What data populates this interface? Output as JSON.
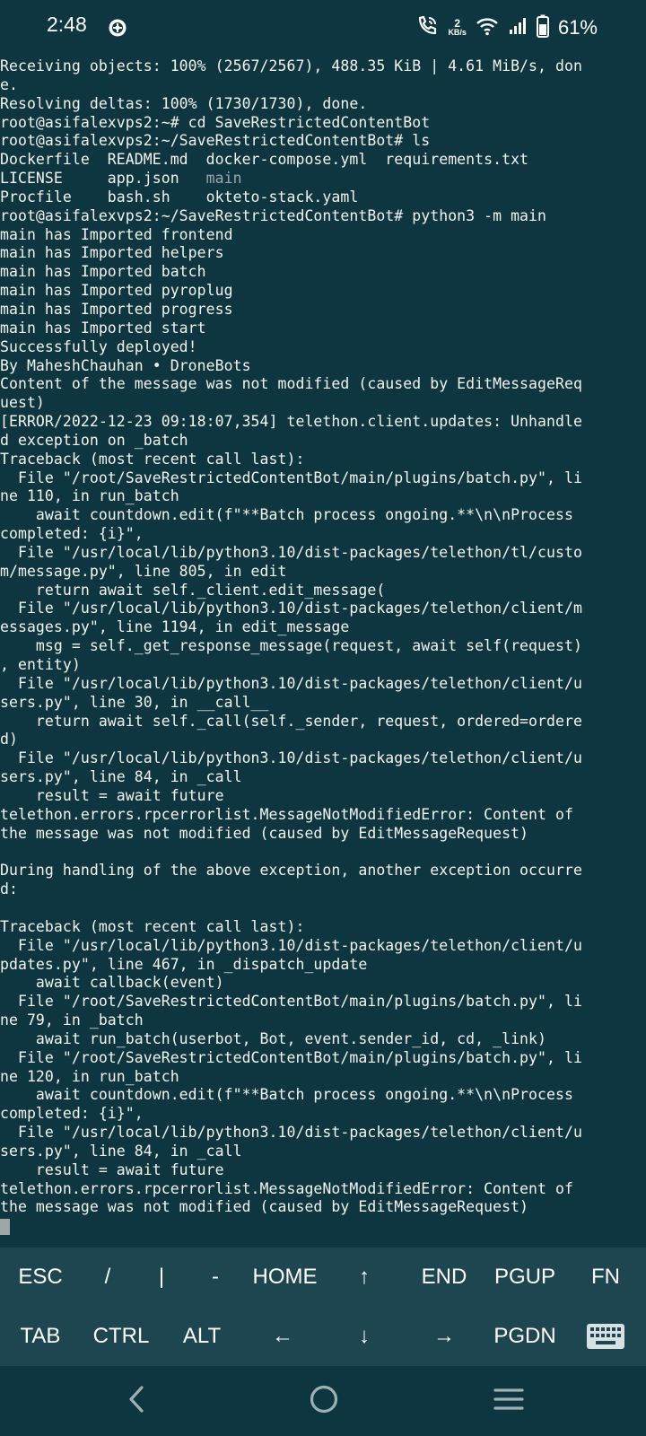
{
  "status_bar": {
    "time": "2:48",
    "net_speed_value": "2",
    "net_speed_unit": "KB/s",
    "battery_percent": "61%",
    "icons": [
      "wifi-calling-icon",
      "wifi-icon",
      "signal-icon",
      "battery-icon",
      "notification-app-icon"
    ]
  },
  "terminal": {
    "lines": [
      "Receiving objects: 100% (2567/2567), 488.35 KiB | 4.61 MiB/s, don",
      "e.",
      "Resolving deltas: 100% (1730/1730), done.",
      "root@asifalexvps2:~# cd SaveRestrictedContentBot",
      "root@asifalexvps2:~/SaveRestrictedContentBot# ls",
      "Dockerfile  README.md  docker-compose.yml  requirements.txt",
      "LICENSE     app.json   main",
      "Procfile    bash.sh    okteto-stack.yaml",
      "root@asifalexvps2:~/SaveRestrictedContentBot# python3 -m main",
      "main has Imported frontend",
      "main has Imported helpers",
      "main has Imported batch",
      "main has Imported pyroplug",
      "main has Imported progress",
      "main has Imported start",
      "Successfully deployed!",
      "By MaheshChauhan • DroneBots",
      "Content of the message was not modified (caused by EditMessageReq",
      "uest)",
      "[ERROR/2022-12-23 09:18:07,354] telethon.client.updates: Unhandle",
      "d exception on _batch",
      "Traceback (most recent call last):",
      "  File \"/root/SaveRestrictedContentBot/main/plugins/batch.py\", li",
      "ne 110, in run_batch",
      "    await countdown.edit(f\"**Batch process ongoing.**\\n\\nProcess",
      "completed: {i}\",",
      "  File \"/usr/local/lib/python3.10/dist-packages/telethon/tl/custo",
      "m/message.py\", line 805, in edit",
      "    return await self._client.edit_message(",
      "  File \"/usr/local/lib/python3.10/dist-packages/telethon/client/m",
      "essages.py\", line 1194, in edit_message",
      "    msg = self._get_response_message(request, await self(request)",
      ", entity)",
      "  File \"/usr/local/lib/python3.10/dist-packages/telethon/client/u",
      "sers.py\", line 30, in __call__",
      "    return await self._call(self._sender, request, ordered=ordere",
      "d)",
      "  File \"/usr/local/lib/python3.10/dist-packages/telethon/client/u",
      "sers.py\", line 84, in _call",
      "    result = await future",
      "telethon.errors.rpcerrorlist.MessageNotModifiedError: Content of",
      "the message was not modified (caused by EditMessageRequest)",
      "",
      "During handling of the above exception, another exception occurre",
      "d:",
      "",
      "Traceback (most recent call last):",
      "  File \"/usr/local/lib/python3.10/dist-packages/telethon/client/u",
      "pdates.py\", line 467, in _dispatch_update",
      "    await callback(event)",
      "  File \"/root/SaveRestrictedContentBot/main/plugins/batch.py\", li",
      "ne 79, in _batch",
      "    await run_batch(userbot, Bot, event.sender_id, cd, _link)",
      "  File \"/root/SaveRestrictedContentBot/main/plugins/batch.py\", li",
      "ne 120, in run_batch",
      "    await countdown.edit(f\"**Batch process ongoing.**\\n\\nProcess",
      "completed: {i}\",",
      "  File \"/usr/local/lib/python3.10/dist-packages/telethon/client/u",
      "sers.py\", line 84, in _call",
      "    result = await future",
      "telethon.errors.rpcerrorlist.MessageNotModifiedError: Content of",
      "the message was not modified (caused by EditMessageRequest)"
    ]
  },
  "extra_keys": {
    "row1": [
      "ESC",
      "/",
      "|",
      "-",
      "HOME",
      "↑",
      "END",
      "PGUP",
      "FN"
    ],
    "row2": [
      "TAB",
      "CTRL",
      "ALT",
      "←",
      "↓",
      "→",
      "PGDN"
    ]
  },
  "nav_bar": {
    "buttons": [
      "back-icon",
      "home-icon",
      "recents-icon"
    ]
  },
  "colors": {
    "background": "#0e3640",
    "extra_keys_bg": "#1e4650",
    "text": "#f4f4ee",
    "dim_text": "#9aa7ab"
  }
}
